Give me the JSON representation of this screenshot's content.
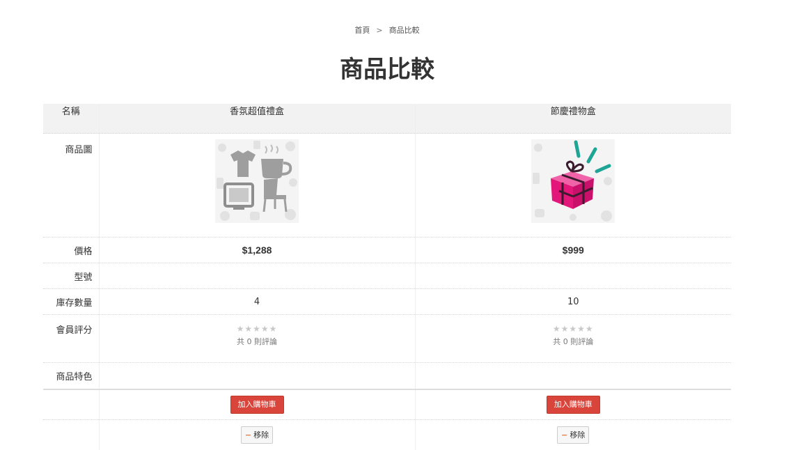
{
  "breadcrumb": {
    "home": "首頁",
    "separator": ">",
    "current": "商品比較"
  },
  "page_title": "商品比較",
  "labels": {
    "name": "名稱",
    "image": "商品圖",
    "price": "價格",
    "model": "型號",
    "stock": "庫存數量",
    "rating": "會員評分",
    "features": "商品特色"
  },
  "products": [
    {
      "name": "香氛超值禮盒",
      "image_icon": "placeholder-household-goods-image",
      "price": "$1,288",
      "model": "",
      "stock": "4",
      "rating_stars": "★★★★★",
      "reviews": "共 0 則評論",
      "features": "",
      "add_to_cart": "加入購物車",
      "remove": "移除",
      "remove_icon": "−"
    },
    {
      "name": "節慶禮物盒",
      "image_icon": "gift-box-image",
      "price": "$999",
      "model": "",
      "stock": "10",
      "rating_stars": "★★★★★",
      "reviews": "共 0 則評論",
      "features": "",
      "add_to_cart": "加入購物車",
      "remove": "移除",
      "remove_icon": "−"
    }
  ],
  "colors": {
    "cart_button": "#d9443b",
    "header_row": "#f2f2f2",
    "gift_pink": "#e3167a",
    "gift_teal": "#1fa596"
  }
}
